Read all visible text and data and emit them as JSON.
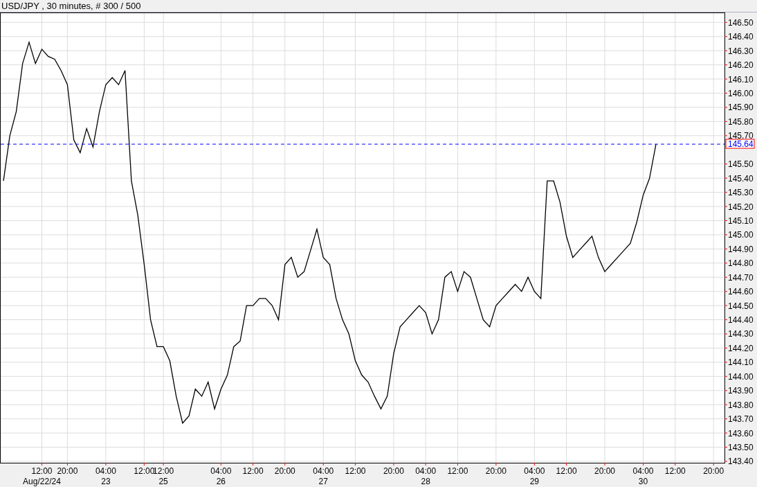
{
  "title": "USD/JPY , 30 minutes, # 300 / 500",
  "chart": {
    "chart_data": {
      "type": "line",
      "categories": [
        null,
        null,
        null,
        null,
        null,
        null,
        "12:00",
        null,
        null,
        null,
        "20:00",
        null,
        null,
        null,
        null,
        null,
        "04:00",
        null,
        null,
        null,
        null,
        null,
        "12:00",
        null,
        null,
        "12:00",
        null,
        null,
        null,
        null,
        null,
        null,
        null,
        null,
        "04:00",
        null,
        null,
        null,
        null,
        "12:00",
        null,
        null,
        null,
        null,
        "20:00",
        null,
        null,
        null,
        null,
        null,
        "04:00",
        null,
        null,
        null,
        null,
        "12:00",
        null,
        null,
        null,
        null,
        null,
        "20:00",
        null,
        null,
        null,
        null,
        "04:00",
        null,
        null,
        null,
        null,
        "12:00",
        null,
        null,
        null,
        null,
        null,
        "20:00",
        null,
        null,
        null,
        null,
        null,
        "04:00",
        null,
        null,
        null,
        null,
        "12:00",
        null,
        null,
        null,
        null,
        null,
        "20:00",
        null,
        null,
        null,
        null,
        null,
        "04:00",
        null,
        null,
        null,
        null,
        "12:00",
        null,
        null,
        null,
        null,
        null,
        "20:00"
      ],
      "series": [
        {
          "color": "#000000",
          "values": [
            145.38,
            145.7,
            145.87,
            146.21,
            146.36,
            146.21,
            146.31,
            146.26,
            146.24,
            146.16,
            146.06,
            145.67,
            145.58,
            145.75,
            145.62,
            145.87,
            146.06,
            146.11,
            146.06,
            146.16,
            145.38,
            145.14,
            144.79,
            144.4,
            144.21,
            144.21,
            144.11,
            143.86,
            143.67,
            143.72,
            143.91,
            143.86,
            143.96,
            143.77,
            143.91,
            144.01,
            144.21,
            144.25,
            144.5,
            144.5,
            144.55,
            144.55,
            144.5,
            144.4,
            144.79,
            144.84,
            144.7,
            144.74,
            144.89,
            145.04,
            144.84,
            144.79,
            144.55,
            144.4,
            144.3,
            144.11,
            144.01,
            143.96,
            143.86,
            143.77,
            143.86,
            144.16,
            144.35,
            144.4,
            144.45,
            144.5,
            144.45,
            144.3,
            144.4,
            144.7,
            144.74,
            144.6,
            144.74,
            144.7,
            144.55,
            144.4,
            144.35,
            144.5,
            144.55,
            144.6,
            144.65,
            144.6,
            144.7,
            144.6,
            144.55,
            145.38,
            145.38,
            145.23,
            144.99,
            144.84,
            144.89,
            144.94,
            144.99,
            144.84,
            144.74,
            144.79,
            144.84,
            144.89,
            144.94,
            145.09,
            145.28,
            145.4,
            145.64,
            null,
            null,
            null,
            null,
            null,
            null,
            null,
            null,
            null
          ]
        }
      ],
      "ylim": [
        143.39,
        146.57
      ],
      "yticks": [
        {
          "value": 143.4,
          "label": "143.40"
        },
        {
          "value": 143.5,
          "label": "143.50"
        },
        {
          "value": 143.6,
          "label": "143.60"
        },
        {
          "value": 143.7,
          "label": "143.70"
        },
        {
          "value": 143.8,
          "label": "143.80"
        },
        {
          "value": 143.9,
          "label": "143.90"
        },
        {
          "value": 144.0,
          "label": "144.00"
        },
        {
          "value": 144.1,
          "label": "144.10"
        },
        {
          "value": 144.2,
          "label": "144.20"
        },
        {
          "value": 144.3,
          "label": "144.30"
        },
        {
          "value": 144.4,
          "label": "144.40"
        },
        {
          "value": 144.5,
          "label": "144.50"
        },
        {
          "value": 144.6,
          "label": "144.60"
        },
        {
          "value": 144.7,
          "label": "144.70"
        },
        {
          "value": 144.8,
          "label": "144.80"
        },
        {
          "value": 144.9,
          "label": "144.90"
        },
        {
          "value": 145.0,
          "label": "145.00"
        },
        {
          "value": 145.1,
          "label": "145.10"
        },
        {
          "value": 145.2,
          "label": "145.20"
        },
        {
          "value": 145.3,
          "label": "145.30"
        },
        {
          "value": 145.4,
          "label": "145.40"
        },
        {
          "value": 145.5,
          "label": "145.50"
        },
        {
          "value": 145.7,
          "label": "145.70"
        },
        {
          "value": 145.8,
          "label": "145.80"
        },
        {
          "value": 145.9,
          "label": "145.90"
        },
        {
          "value": 146.0,
          "label": "146.00"
        },
        {
          "value": 146.1,
          "label": "146.10"
        },
        {
          "value": 146.2,
          "label": "146.20"
        },
        {
          "value": 146.3,
          "label": "146.30"
        },
        {
          "value": 146.4,
          "label": "146.40"
        },
        {
          "value": 146.5,
          "label": "146.50"
        }
      ],
      "grid": true,
      "ref_lines": [
        {
          "axis": "y",
          "value": 145.64,
          "label": "145.64"
        }
      ]
    },
    "dates": [
      "Aug/22/24",
      "23",
      "25",
      "26",
      "27",
      "28",
      "29",
      "30"
    ]
  }
}
